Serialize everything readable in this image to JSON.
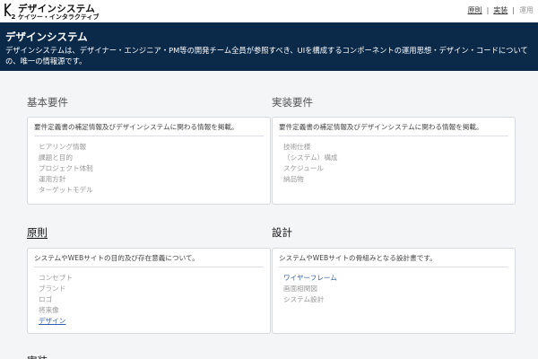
{
  "header": {
    "logo_title": "デザインシステム",
    "logo_sub": "ケイツー・インタラクティブ",
    "nav": [
      {
        "label": "原則",
        "state": "link"
      },
      {
        "label": "実装",
        "state": "link"
      },
      {
        "label": "運用",
        "state": "disabled"
      }
    ]
  },
  "hero": {
    "title": "デザインシステム",
    "description": "デザインシステムは、デザイナー・エンジニア・PM等の開発チーム全員が参照すべき、UIを構成するコンポーネントの運用思想・デザイン・コードについての、唯一の情報源です。"
  },
  "sections": {
    "basic": {
      "title": "基本要件",
      "desc": "要件定義書の補足情報及びデザインシステムに関わる情報を掲載。",
      "items": [
        "ヒアリング情報",
        "課題と目的",
        "プロジェクト体制",
        "運用方針",
        "ターゲットモデル"
      ]
    },
    "impl": {
      "title": "実装要件",
      "desc": "要件定義書の補足情報及びデザインシステムに関わる情報を掲載。",
      "items": [
        "技術仕様",
        "（システム）構成",
        "スケジュール",
        "納品物"
      ]
    },
    "principles": {
      "title": "原則",
      "desc": "システムやWEBサイトの目的及び存在意義について。",
      "items": [
        "コンセプト",
        "ブランド",
        "ロゴ",
        "将来像",
        "デザイン"
      ]
    },
    "design": {
      "title": "設計",
      "desc": "システムやWEBサイトの骨組みとなる設計書です。",
      "items": [
        "ワイヤーフレーム",
        "画面相関図",
        "システム設計"
      ]
    }
  },
  "partial_title": "実装"
}
